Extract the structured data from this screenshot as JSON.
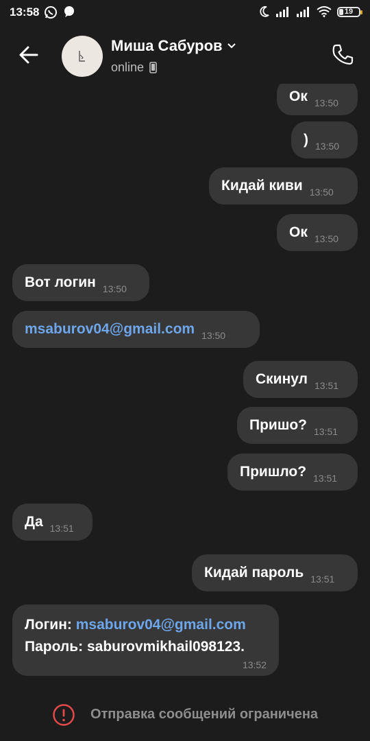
{
  "status_bar": {
    "time": "13:58",
    "battery_level": "19",
    "left_icons": [
      "whatsapp-icon",
      "chat-bubble-icon"
    ],
    "right_icons": [
      "moon-icon",
      "signal-icon",
      "signal-icon",
      "wifi-icon",
      "battery-icon"
    ]
  },
  "header": {
    "contact_name": "Миша Сабуров",
    "status": "online",
    "back_icon": "arrow-left-icon",
    "call_icon": "phone-icon",
    "dropdown_icon": "chevron-down-icon"
  },
  "messages": [
    {
      "dir": "out",
      "text": "Ок",
      "time": "13:50"
    },
    {
      "dir": "out",
      "text": ")",
      "time": "13:50"
    },
    {
      "dir": "out",
      "text": "Кидай киви",
      "time": "13:50"
    },
    {
      "dir": "out",
      "text": "Ок",
      "time": "13:50"
    },
    {
      "dir": "in",
      "text": "Вот логин",
      "time": "13:50"
    },
    {
      "dir": "in",
      "text": "msaburov04@gmail.com",
      "time": "13:50"
    },
    {
      "dir": "out",
      "text": "Скинул",
      "time": "13:51"
    },
    {
      "dir": "out",
      "text": "Пришо?",
      "time": "13:51"
    },
    {
      "dir": "out",
      "text": "Пришло?",
      "time": "13:51"
    },
    {
      "dir": "in",
      "text": "Да",
      "time": "13:51"
    },
    {
      "dir": "out",
      "text": "Кидай пароль",
      "time": "13:51"
    }
  ],
  "last_message": {
    "login_label": "Логин: ",
    "login_value": "msaburov04@gmail.com",
    "password_line": "Пароль: saburovmikhail098123.",
    "time": "13:52"
  },
  "footer": {
    "notice": "Отправка сообщений ограничена",
    "icon": "alert-circle-icon"
  },
  "colors": {
    "background": "#1c1c1c",
    "bubble": "#373737",
    "link": "#6ea6ec",
    "alert": "#e24a4a"
  }
}
